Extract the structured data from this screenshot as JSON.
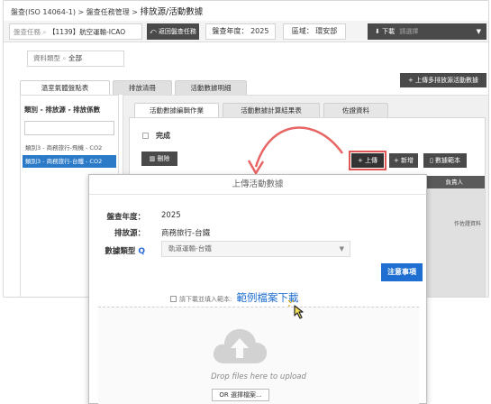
{
  "breadcrumb": {
    "path": "盤查(ISO 14064-1) > 盤查任務管理 > ",
    "current": "排放源/活動數據"
  },
  "toolbar": {
    "audit_key": "盤查任務",
    "audit_value": "【1139】航空運輸-ICAO",
    "back_label": "返回盤查任務",
    "year_label": "盤查年度：",
    "year_value": "2025",
    "area_label": "區域：",
    "area_value": "環安部",
    "download_label": "下載",
    "download_placeholder": "請選擇"
  },
  "data_type": {
    "label": "資料類型",
    "value": "全部"
  },
  "multi_upload_label": "+ 上傳多排放源活動數據",
  "main_tabs": [
    "溫室氣體盤點表",
    "排放清冊",
    "活動數據明細"
  ],
  "left_panel": {
    "title": "類別 - 排放源 - 排放係數",
    "items": [
      "類別3 - 商務旅行-飛機 - CO2",
      "類別3 - 商務旅行-台鐵 - CO2"
    ]
  },
  "sub_tabs": [
    "活動數據編輯作業",
    "活動數據計算結果表",
    "佐證資料"
  ],
  "right_panel": {
    "done_label": "完成",
    "delete_label": "刪除",
    "upload_label": "+ 上傳",
    "add_label": "+ 新增",
    "sample_label": "數據範本",
    "owner_col": "負責人",
    "note": "作佐證資料"
  },
  "modal": {
    "title": "上傳活動數據",
    "year_label": "盤查年度：",
    "year_value": "2025",
    "source_label": "排放源：",
    "source_value": "商務旅行-台鐵",
    "type_label": "數據類型",
    "type_value": "軌道運輸-台鐵",
    "notice_label": "注意事項",
    "download_hint": "請下載並填入範本:",
    "download_link": "範例檔案下載",
    "drop_text": "Drop files here to upload",
    "choose_label": "OR 選擇檔案..."
  },
  "colors": {
    "primary": "#1f6fd2",
    "dark_button": "#4a4a4a",
    "highlight": "#e05555",
    "selected_row": "#2a7ac8"
  }
}
